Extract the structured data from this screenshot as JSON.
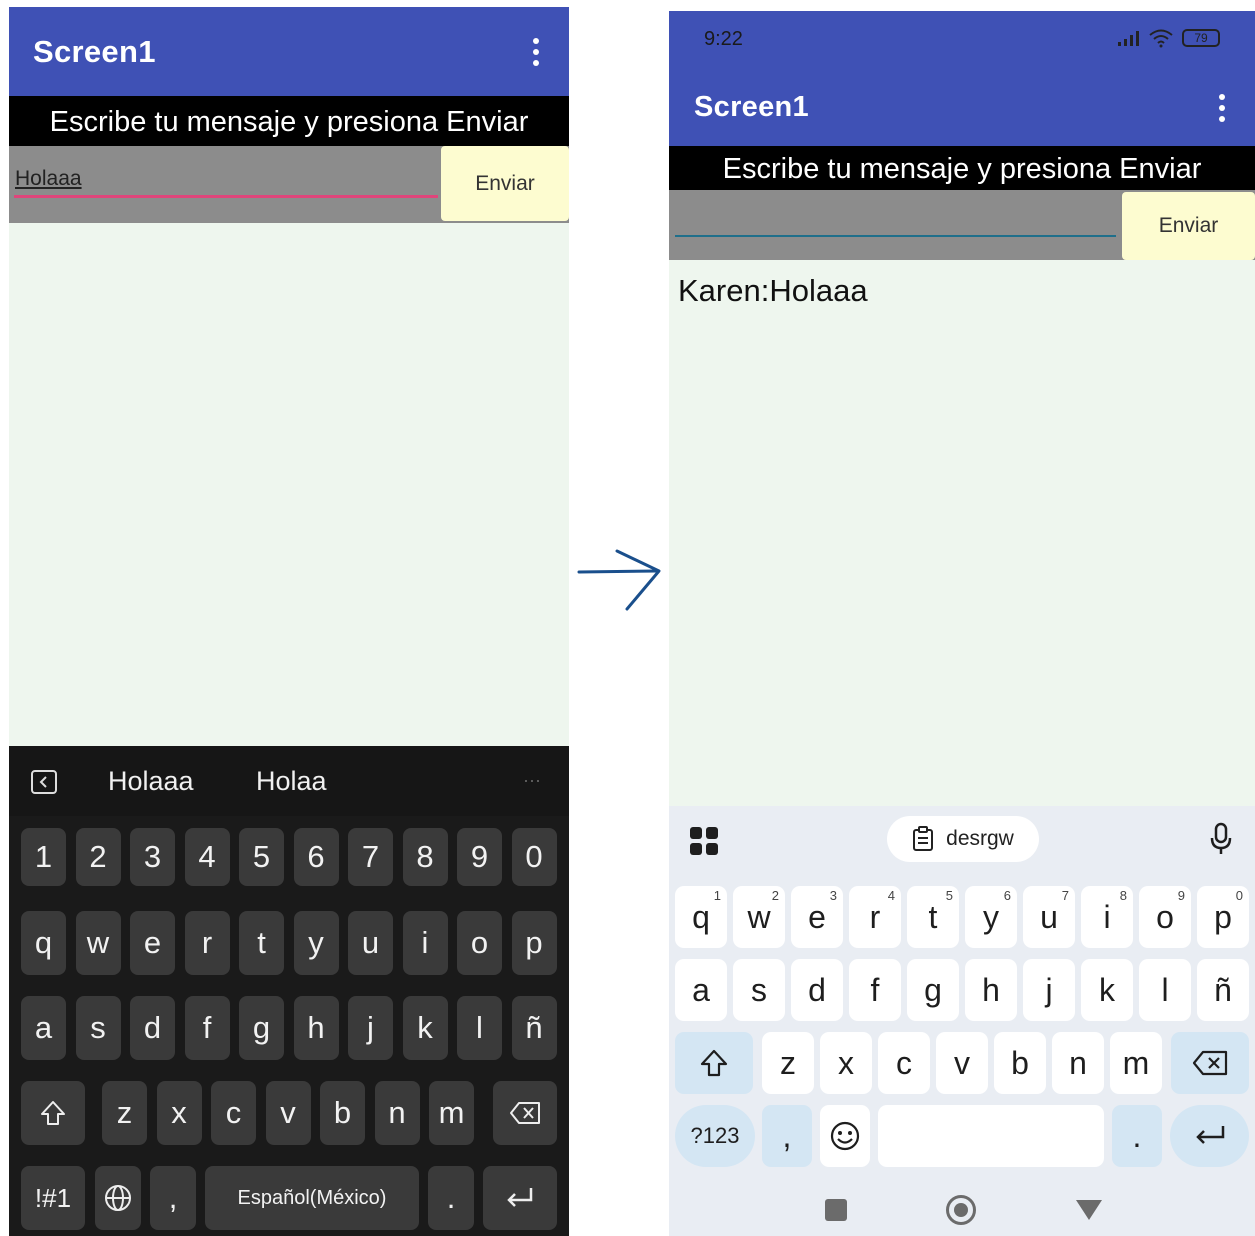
{
  "left_screen": {
    "app_title": "Screen1",
    "instruction": "Escribe tu mensaje y presiona Enviar",
    "input_value": "Holaaa",
    "send_label": "Enviar",
    "keyboard": {
      "suggestions": [
        "Holaaa",
        "Holaa"
      ],
      "more": "···",
      "number_row": [
        "1",
        "2",
        "3",
        "4",
        "5",
        "6",
        "7",
        "8",
        "9",
        "0"
      ],
      "row1": [
        "q",
        "w",
        "e",
        "r",
        "t",
        "y",
        "u",
        "i",
        "o",
        "p"
      ],
      "row2": [
        "a",
        "s",
        "d",
        "f",
        "g",
        "h",
        "j",
        "k",
        "l",
        "ñ"
      ],
      "row3": [
        "z",
        "x",
        "c",
        "v",
        "b",
        "n",
        "m"
      ],
      "symbols_label": "!#1",
      "comma": ",",
      "space_label": "Español(México)",
      "period": "."
    }
  },
  "right_screen": {
    "status_time": "9:22",
    "battery_level": "79",
    "app_title": "Screen1",
    "instruction": "Escribe tu mensaje y presiona Enviar",
    "input_value": "",
    "send_label": "Enviar",
    "message": "Karen:Holaaa",
    "keyboard": {
      "clipboard_suggestion": "desrgw",
      "row1": [
        "q",
        "w",
        "e",
        "r",
        "t",
        "y",
        "u",
        "i",
        "o",
        "p"
      ],
      "row1_hints": [
        "1",
        "2",
        "3",
        "4",
        "5",
        "6",
        "7",
        "8",
        "9",
        "0"
      ],
      "row2": [
        "a",
        "s",
        "d",
        "f",
        "g",
        "h",
        "j",
        "k",
        "l",
        "ñ"
      ],
      "row3": [
        "z",
        "x",
        "c",
        "v",
        "b",
        "n",
        "m"
      ],
      "numbers_label": "?123",
      "comma": ",",
      "period": "."
    }
  },
  "colors": {
    "appbar": "#3f51b5",
    "canvas": "#eef6ee",
    "button": "#fdfcd0",
    "input_row": "#8c8c8c",
    "left_underline": "#e0457b",
    "right_underline": "#1f6f8b",
    "arrow": "#1a4f8c"
  }
}
